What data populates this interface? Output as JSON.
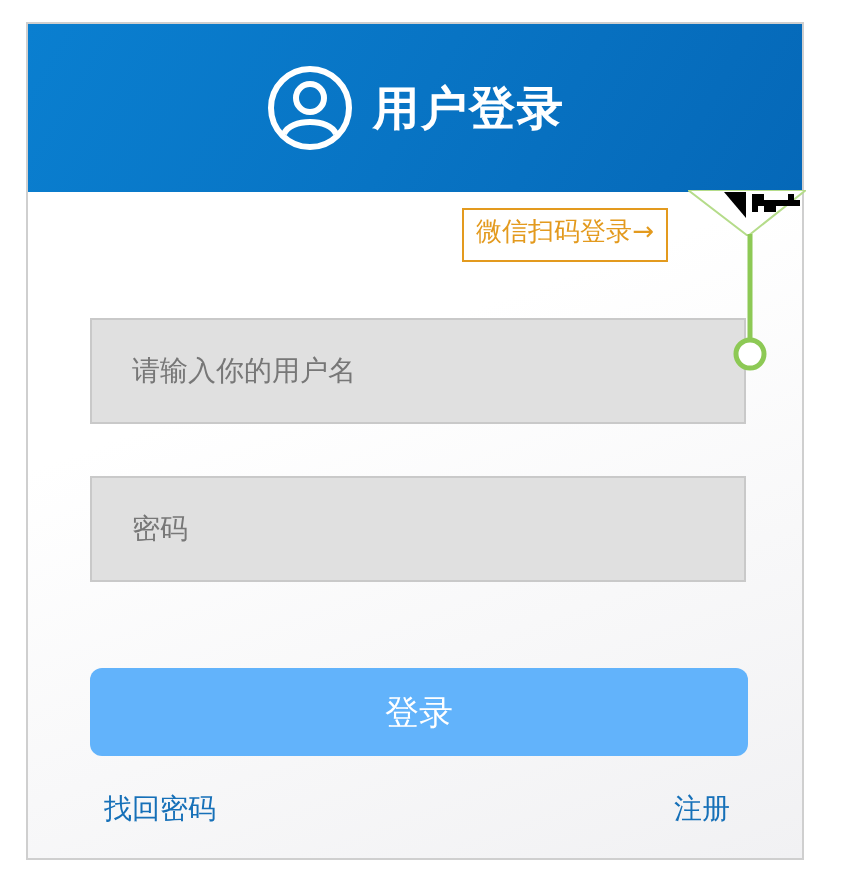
{
  "header": {
    "title": "用户登录"
  },
  "wechat_login": {
    "label": "微信扫码登录→"
  },
  "fields": [
    {
      "placeholder": "请输入你的用户名"
    },
    {
      "placeholder": "密码"
    }
  ],
  "login_button": {
    "label": "登录"
  },
  "links": [
    {
      "label": "找回密码"
    },
    {
      "label": "注册"
    }
  ]
}
